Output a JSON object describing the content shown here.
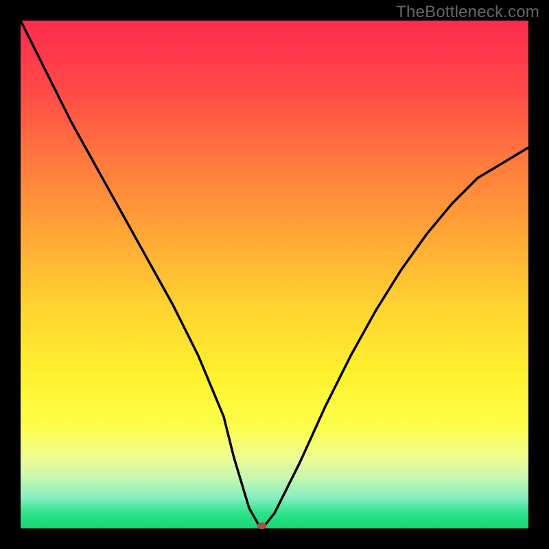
{
  "watermark": "TheBottleneck.com",
  "chart_data": {
    "type": "line",
    "title": "",
    "xlabel": "",
    "ylabel": "",
    "xlim": [
      0,
      100
    ],
    "ylim": [
      0,
      100
    ],
    "grid": false,
    "legend": false,
    "note": "V-shaped bottleneck curve over a vertical temperature gradient (red at top = high bottleneck, green at bottom = low bottleneck). A red marker sits at the minimum of the curve.",
    "series": [
      {
        "name": "bottleneck_curve",
        "x": [
          0,
          5,
          10,
          15,
          20,
          25,
          30,
          35,
          40,
          42,
          45,
          47,
          48,
          50,
          55,
          60,
          65,
          70,
          75,
          80,
          85,
          90,
          95,
          100
        ],
        "y": [
          100,
          90,
          80,
          71,
          62,
          53,
          44,
          34,
          22,
          14,
          4,
          0.5,
          0.5,
          3,
          13,
          24,
          34,
          43,
          51,
          58,
          64,
          69,
          72,
          75
        ]
      }
    ],
    "marker": {
      "x": 47.5,
      "y": 0.5,
      "color": "#b44a45",
      "rx": 7,
      "ry": 5
    },
    "gradient_stops": [
      {
        "pos": 0,
        "color": "#ff2a4f"
      },
      {
        "pos": 14,
        "color": "#ff4b46"
      },
      {
        "pos": 28,
        "color": "#ff7a3e"
      },
      {
        "pos": 42,
        "color": "#ffa636"
      },
      {
        "pos": 56,
        "color": "#ffd231"
      },
      {
        "pos": 70,
        "color": "#fff22e"
      },
      {
        "pos": 80,
        "color": "#fdfe4b"
      },
      {
        "pos": 86,
        "color": "#effd91"
      },
      {
        "pos": 90,
        "color": "#c7f7b1"
      },
      {
        "pos": 94,
        "color": "#85eec1"
      },
      {
        "pos": 97,
        "color": "#2de28a"
      },
      {
        "pos": 100,
        "color": "#17d873"
      }
    ]
  }
}
